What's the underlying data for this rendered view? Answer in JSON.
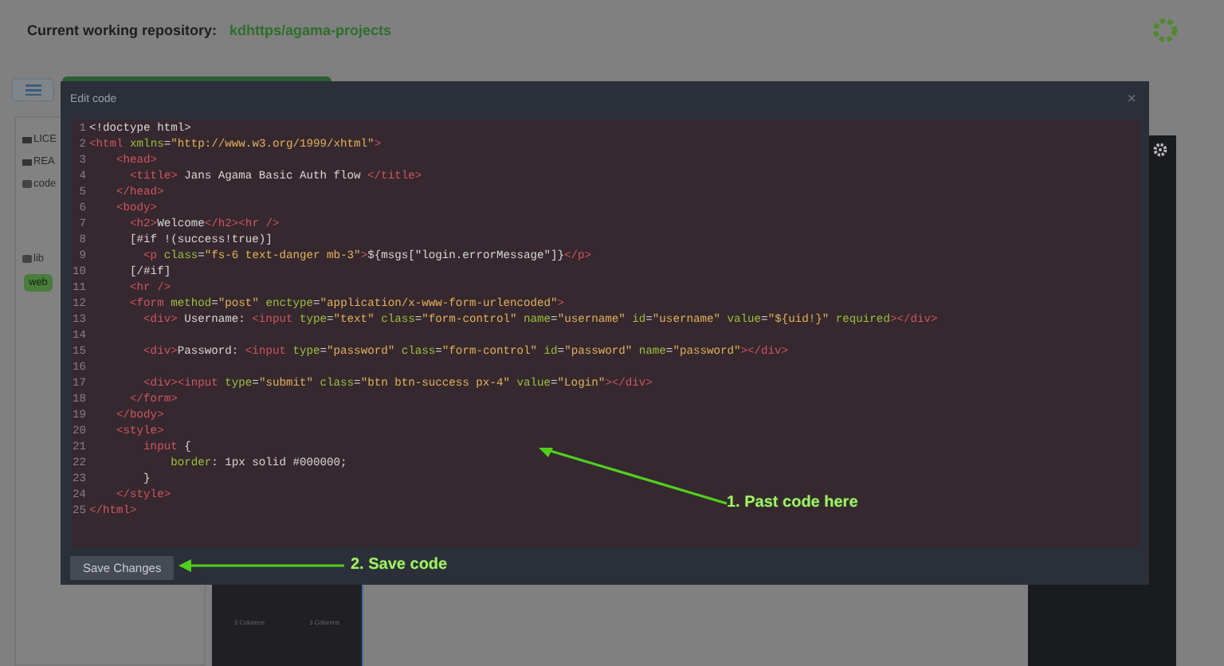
{
  "header": {
    "label": "Current working repository:",
    "repository": "kdhttps/agama-projects"
  },
  "sidebar": {
    "items": [
      {
        "label": "LICE",
        "kind": "file",
        "selected": false
      },
      {
        "label": "REA",
        "kind": "file",
        "selected": false
      },
      {
        "label": "code",
        "kind": "folder",
        "selected": false
      },
      {
        "label": "lib",
        "kind": "folder",
        "selected": false
      },
      {
        "label": "web",
        "kind": "badge",
        "selected": true
      }
    ]
  },
  "blocks_panel": {
    "items": [
      "2 Columns",
      "3 Columns"
    ]
  },
  "modal": {
    "title": "Edit code",
    "close": "×",
    "save_button": "Save Changes",
    "lines": [
      {
        "number": "1",
        "segments": [
          {
            "kind": "text",
            "text": "<!doctype html>"
          }
        ]
      },
      {
        "number": "2",
        "segments": [
          {
            "kind": "tag",
            "text": "<html "
          },
          {
            "kind": "attr",
            "text": "xmlns"
          },
          {
            "kind": "text",
            "text": "="
          },
          {
            "kind": "string",
            "text": "\"http://www.w3.org/1999/xhtml\""
          },
          {
            "kind": "tag",
            "text": ">"
          }
        ]
      },
      {
        "number": "3",
        "segments": [
          {
            "kind": "tag",
            "text": "    <head>"
          }
        ]
      },
      {
        "number": "4",
        "segments": [
          {
            "kind": "tag",
            "text": "      <title>"
          },
          {
            "kind": "text",
            "text": " Jans Agama Basic Auth flow "
          },
          {
            "kind": "tag",
            "text": "</title>"
          }
        ]
      },
      {
        "number": "5",
        "segments": [
          {
            "kind": "tag",
            "text": "    </head>"
          }
        ]
      },
      {
        "number": "6",
        "segments": [
          {
            "kind": "tag",
            "text": "    <body>"
          }
        ]
      },
      {
        "number": "7",
        "segments": [
          {
            "kind": "tag",
            "text": "      <h2>"
          },
          {
            "kind": "text",
            "text": "Welcome"
          },
          {
            "kind": "tag",
            "text": "</h2><hr />"
          }
        ]
      },
      {
        "number": "8",
        "segments": [
          {
            "kind": "text",
            "text": "      [#if !(success!true)]"
          }
        ]
      },
      {
        "number": "9",
        "segments": [
          {
            "kind": "tag",
            "text": "        <p "
          },
          {
            "kind": "attr",
            "text": "class"
          },
          {
            "kind": "text",
            "text": "="
          },
          {
            "kind": "string",
            "text": "\"fs-6 text-danger mb-3\""
          },
          {
            "kind": "tag",
            "text": ">"
          },
          {
            "kind": "text",
            "text": "${msgs[\"login.errorMessage\"]}"
          },
          {
            "kind": "tag",
            "text": "</p>"
          }
        ]
      },
      {
        "number": "10",
        "segments": [
          {
            "kind": "text",
            "text": "      [/#if]"
          }
        ]
      },
      {
        "number": "11",
        "segments": [
          {
            "kind": "tag",
            "text": "      <hr />"
          }
        ]
      },
      {
        "number": "12",
        "segments": [
          {
            "kind": "tag",
            "text": "      <form "
          },
          {
            "kind": "attr",
            "text": "method"
          },
          {
            "kind": "text",
            "text": "="
          },
          {
            "kind": "string",
            "text": "\"post\" "
          },
          {
            "kind": "attr",
            "text": "enctype"
          },
          {
            "kind": "text",
            "text": "="
          },
          {
            "kind": "string",
            "text": "\"application/x-www-form-urlencoded\""
          },
          {
            "kind": "tag",
            "text": ">"
          }
        ]
      },
      {
        "number": "13",
        "segments": [
          {
            "kind": "tag",
            "text": "        <div>"
          },
          {
            "kind": "text",
            "text": " Username: "
          },
          {
            "kind": "tag",
            "text": "<input "
          },
          {
            "kind": "attr",
            "text": "type"
          },
          {
            "kind": "text",
            "text": "="
          },
          {
            "kind": "string",
            "text": "\"text\" "
          },
          {
            "kind": "attr",
            "text": "class"
          },
          {
            "kind": "text",
            "text": "="
          },
          {
            "kind": "string",
            "text": "\"form-control\" "
          },
          {
            "kind": "attr",
            "text": "name"
          },
          {
            "kind": "text",
            "text": "="
          },
          {
            "kind": "string",
            "text": "\"username\" "
          },
          {
            "kind": "attr",
            "text": "id"
          },
          {
            "kind": "text",
            "text": "="
          },
          {
            "kind": "string",
            "text": "\"username\" "
          },
          {
            "kind": "attr",
            "text": "value"
          },
          {
            "kind": "text",
            "text": "="
          },
          {
            "kind": "string",
            "text": "\"${uid!}\" "
          },
          {
            "kind": "attr",
            "text": "required"
          },
          {
            "kind": "tag",
            "text": "></div>"
          }
        ]
      },
      {
        "number": "14"
      },
      {
        "number": "15",
        "segments": [
          {
            "kind": "tag",
            "text": "        <div>"
          },
          {
            "kind": "text",
            "text": "Password: "
          },
          {
            "kind": "tag",
            "text": "<input "
          },
          {
            "kind": "attr",
            "text": "type"
          },
          {
            "kind": "text",
            "text": "="
          },
          {
            "kind": "string",
            "text": "\"password\" "
          },
          {
            "kind": "attr",
            "text": "class"
          },
          {
            "kind": "text",
            "text": "="
          },
          {
            "kind": "string",
            "text": "\"form-control\" "
          },
          {
            "kind": "attr",
            "text": "id"
          },
          {
            "kind": "text",
            "text": "="
          },
          {
            "kind": "string",
            "text": "\"password\" "
          },
          {
            "kind": "attr",
            "text": "name"
          },
          {
            "kind": "text",
            "text": "="
          },
          {
            "kind": "string",
            "text": "\"password\""
          },
          {
            "kind": "tag",
            "text": "></div>"
          }
        ]
      },
      {
        "number": "16"
      },
      {
        "number": "17",
        "segments": [
          {
            "kind": "tag",
            "text": "        <div><input "
          },
          {
            "kind": "attr",
            "text": "type"
          },
          {
            "kind": "text",
            "text": "="
          },
          {
            "kind": "string",
            "text": "\"submit\" "
          },
          {
            "kind": "attr",
            "text": "class"
          },
          {
            "kind": "text",
            "text": "="
          },
          {
            "kind": "string",
            "text": "\"btn btn-success px-4\" "
          },
          {
            "kind": "attr",
            "text": "value"
          },
          {
            "kind": "text",
            "text": "="
          },
          {
            "kind": "string",
            "text": "\"Login\""
          },
          {
            "kind": "tag",
            "text": "></div>"
          }
        ]
      },
      {
        "number": "18",
        "segments": [
          {
            "kind": "tag",
            "text": "      </form>"
          }
        ]
      },
      {
        "number": "19",
        "segments": [
          {
            "kind": "tag",
            "text": "    </body>"
          }
        ]
      },
      {
        "number": "20",
        "segments": [
          {
            "kind": "tag",
            "text": "    <style>"
          }
        ]
      },
      {
        "number": "21",
        "segments": [
          {
            "kind": "tag",
            "text": "        input "
          },
          {
            "kind": "text",
            "text": "{"
          }
        ]
      },
      {
        "number": "22",
        "segments": [
          {
            "kind": "attr",
            "text": "            border"
          },
          {
            "kind": "text",
            "text": ": 1px solid #000000;"
          }
        ]
      },
      {
        "number": "23",
        "segments": [
          {
            "kind": "text",
            "text": "        }"
          }
        ]
      },
      {
        "number": "24",
        "segments": [
          {
            "kind": "tag",
            "text": "    </style>"
          }
        ]
      },
      {
        "number": "25",
        "segments": [
          {
            "kind": "tag",
            "text": "</html>"
          }
        ]
      }
    ]
  },
  "annotations": [
    {
      "kind": "paste",
      "text": "1. Past code here"
    },
    {
      "kind": "save",
      "text": "2. Save code"
    }
  ]
}
